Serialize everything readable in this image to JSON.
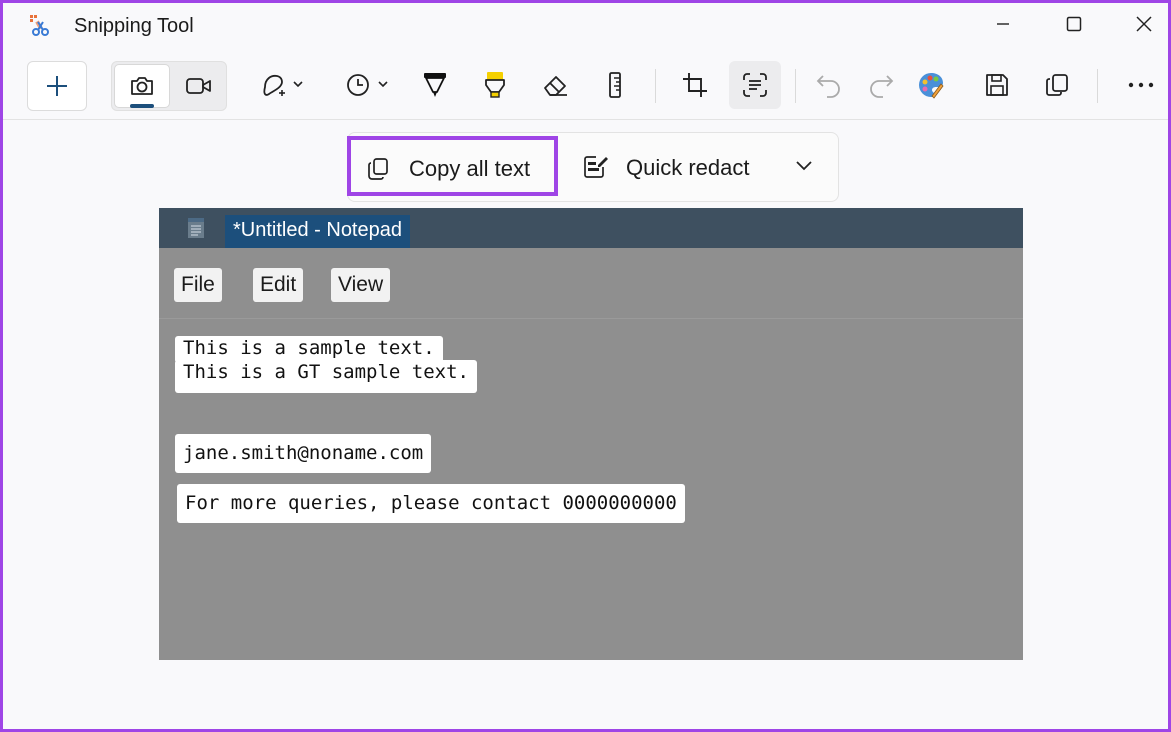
{
  "app": {
    "title": "Snipping Tool"
  },
  "window_controls": [
    "minimize",
    "maximize",
    "close"
  ],
  "toolbar": {
    "new": "new-snip",
    "modes": [
      "snip-mode-screenshot",
      "snip-mode-record"
    ],
    "active_mode": "snip-mode-screenshot",
    "tools": [
      "snip-shape",
      "delay",
      "ballpoint-pen",
      "highlighter",
      "eraser",
      "ruler",
      "crop",
      "text-actions",
      "undo",
      "redo",
      "edit-in-paint",
      "save",
      "copy",
      "more"
    ]
  },
  "text_actions": {
    "copy_all_text": "Copy all text",
    "quick_redact": "Quick redact"
  },
  "notepad": {
    "title": "*Untitled - Notepad",
    "menu": [
      "File",
      "Edit",
      "View"
    ],
    "lines": [
      "This is a sample text.",
      "This is a GT sample text.",
      "jane.smith@noname.com",
      "For more queries, please contact 0000000000"
    ]
  },
  "colors": {
    "highlight_border": "#9f45e6",
    "accent": "#1c4f7c",
    "notepad_titlebar": "#3e5060",
    "snip_background": "#8f8f8f"
  }
}
